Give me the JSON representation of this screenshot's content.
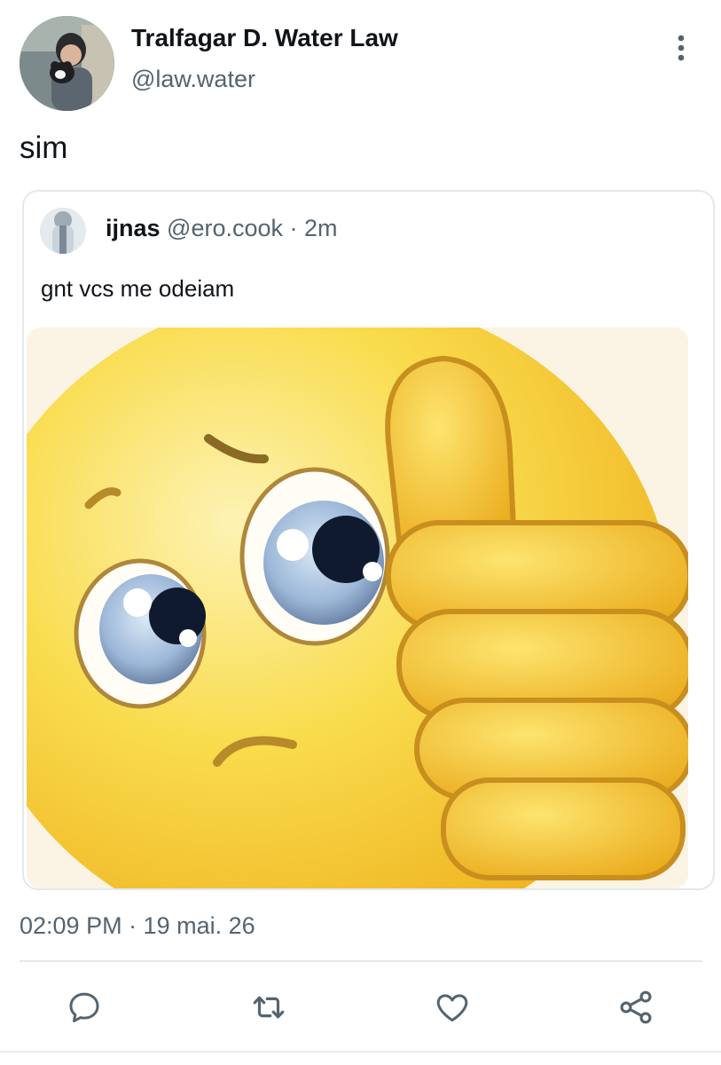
{
  "author": {
    "display_name": "Tralfagar D. Water Law",
    "handle": "@law.water",
    "avatar_icon": "profile-photo-person-holding-cat"
  },
  "tweet": {
    "text": "sim",
    "timestamp": "02:09 PM · 19 mai. 26"
  },
  "quoted": {
    "display_name": "ijnas",
    "handle": "@ero.cook",
    "separator": " · ",
    "age": "2m",
    "text": "gnt vcs me odeiam",
    "media_icon": "sad-thumbs-up-emoji"
  },
  "actions": [
    {
      "name": "reply",
      "icon": "comment-icon"
    },
    {
      "name": "retweet",
      "icon": "repost-icon"
    },
    {
      "name": "like",
      "icon": "heart-icon"
    },
    {
      "name": "share",
      "icon": "share-icon"
    }
  ],
  "colors": {
    "text_primary": "#0f1419",
    "text_secondary": "#536471",
    "border": "#e3e8eb",
    "icon": "#536471"
  }
}
